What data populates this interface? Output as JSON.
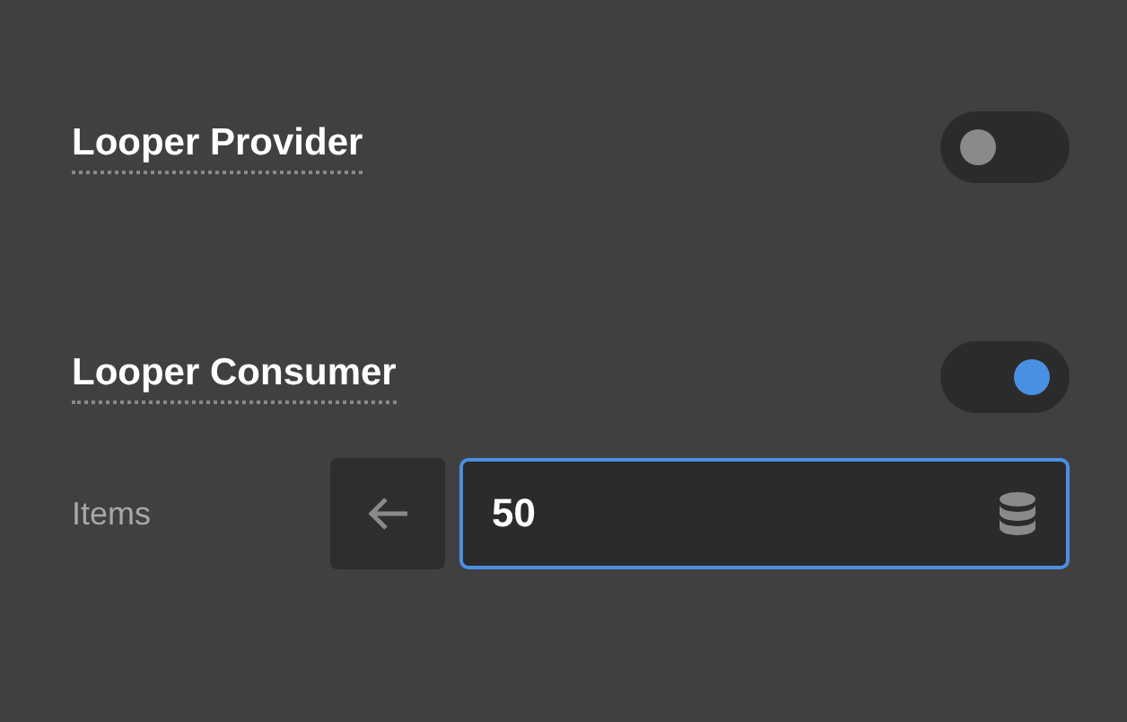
{
  "sections": [
    {
      "title": "Looper Provider",
      "on": false
    },
    {
      "title": "Looper Consumer",
      "on": true
    }
  ],
  "items_field": {
    "label": "Items",
    "value": "50"
  }
}
